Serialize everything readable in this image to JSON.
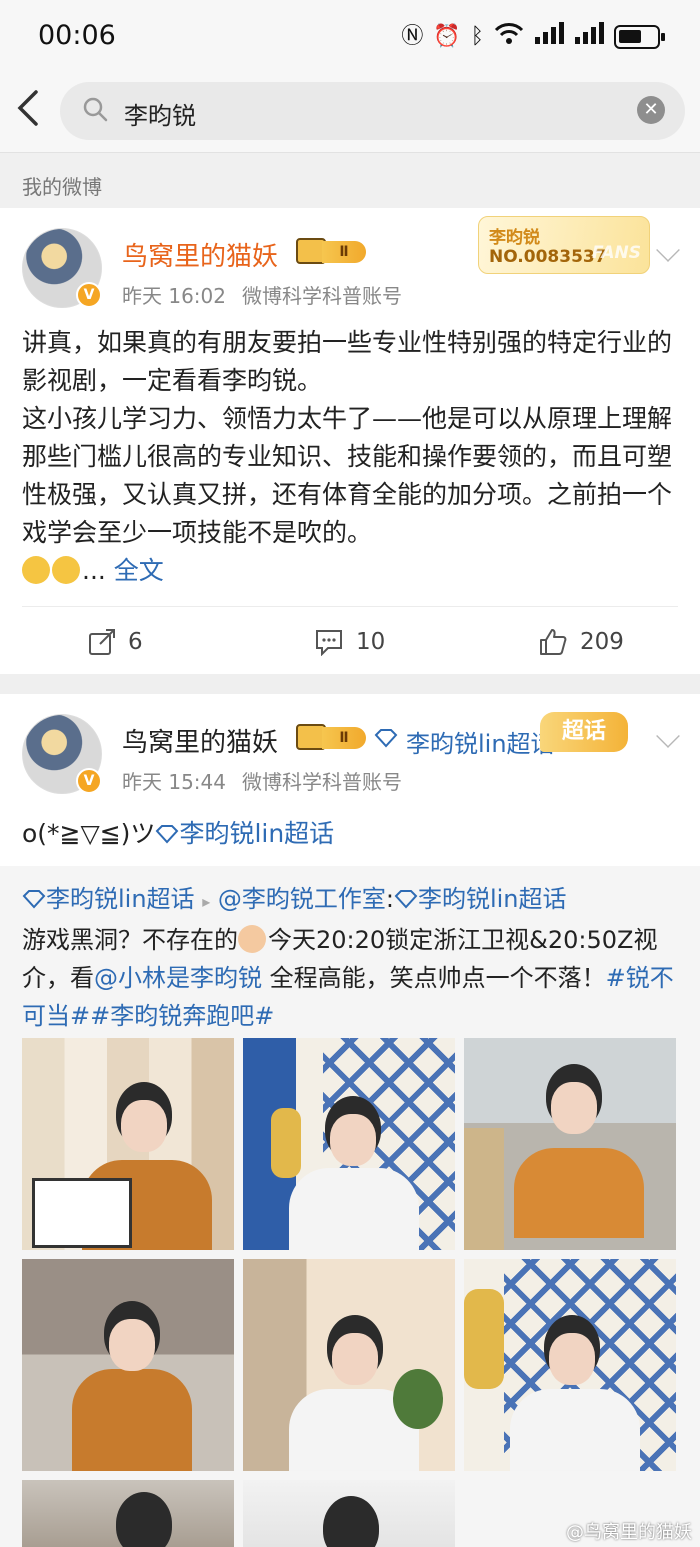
{
  "status_bar": {
    "time": "00:06",
    "icons": [
      "nfc-icon",
      "alarm-icon",
      "bluetooth-icon",
      "wifi-icon",
      "signal-icon",
      "signal-icon",
      "battery-icon"
    ]
  },
  "search": {
    "query": "李昀锐"
  },
  "section": {
    "label": "我的微博"
  },
  "post1": {
    "username": "鸟窝里的猫妖",
    "vip_level": "Ⅱ",
    "time": "昨天 16:02",
    "source": "微博科学科普账号",
    "fans_badge": {
      "name": "李昀锐",
      "number": "NO.0083537",
      "word": "FANS"
    },
    "text_p1": "讲真，如果真的有朋友要拍一些专业性特别强的特定行业的影视剧，一定看看李昀锐。",
    "text_p2": "这小孩儿学习力、领悟力太牛了——他是可以从原理上理解那些门槛儿很高的专业知识、技能和操作要领的，而且可塑性极强，又认真又拼，还有体育全能的加分项。之前拍一个戏学会至少一项技能不是吹的。",
    "ellipsis": "...",
    "more": "全文",
    "reposts": "6",
    "comments": "10",
    "likes": "209"
  },
  "post2": {
    "username": "鸟窝里的猫妖",
    "vip_level": "Ⅱ",
    "topic": "李昀锐lin超话",
    "chaohua_badge": "超话",
    "time": "昨天 15:44",
    "source": "微博科学科普账号",
    "text": "o(*≧▽≦)ツ",
    "text_topic": "李昀锐lin超话",
    "repost": {
      "topic1": "李昀锐lin超话",
      "arrow": "▸",
      "author": "@李昀锐工作室",
      "colon": ":",
      "topic2": "李昀锐lin超话",
      "line_a": "游戏黑洞？不存在的",
      "line_b": "今天20:20锁定浙江卫视&20:50Z视介，看",
      "mention": "@小林是李昀锐",
      "line_c": " 全程高能，笑点帅点一个不落！",
      "hashtags": "#锐不可当##李昀锐奔跑吧#"
    }
  },
  "watermark": "@鸟窝里的猫妖",
  "colors": {
    "accent_orange": "#e8641b",
    "link_blue": "#2e6bb4",
    "gold": "#f4b338"
  }
}
